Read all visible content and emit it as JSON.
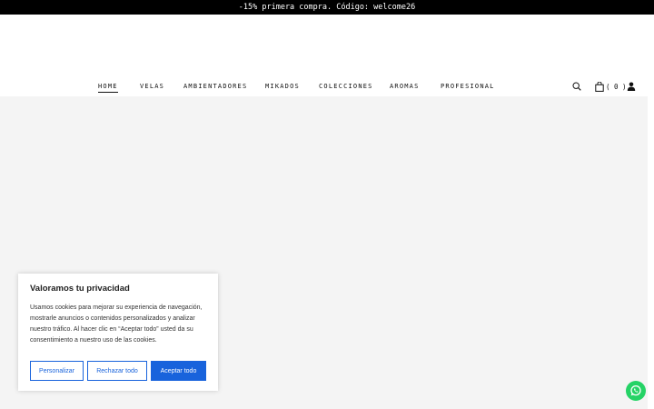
{
  "promo": {
    "text": "-15% primera compra. Código: welcome26"
  },
  "nav": {
    "items": [
      {
        "label": "HOME",
        "active": true
      },
      {
        "label": "VELAS"
      },
      {
        "label": "AMBIENTADORES"
      },
      {
        "label": "MIKADOS"
      },
      {
        "label": "COLECCIONES"
      },
      {
        "label": "AROMAS"
      },
      {
        "label": "PROFESIONAL"
      }
    ]
  },
  "header_icons": {
    "search": "search-icon",
    "cart": "shopping-bag-icon",
    "cart_count": "( 0 )",
    "account": "user-icon"
  },
  "cookie_banner": {
    "title": "Valoramos tu privacidad",
    "text": "Usamos cookies para mejorar su experiencia de navegación, mostrarle anuncios o contenidos personalizados y analizar nuestro tráfico. Al hacer clic en “Aceptar todo” usted da su consentimiento a nuestro uso de las cookies.",
    "buttons": {
      "customize": "Personalizar",
      "reject": "Rechazar todo",
      "accept": "Aceptar todo"
    }
  },
  "colors": {
    "accent": "#1863dc",
    "promo_bg": "#000000",
    "hero_bg": "#f4f4f4",
    "whatsapp": "#25d366"
  },
  "floating": {
    "whatsapp": "whatsapp-icon"
  }
}
